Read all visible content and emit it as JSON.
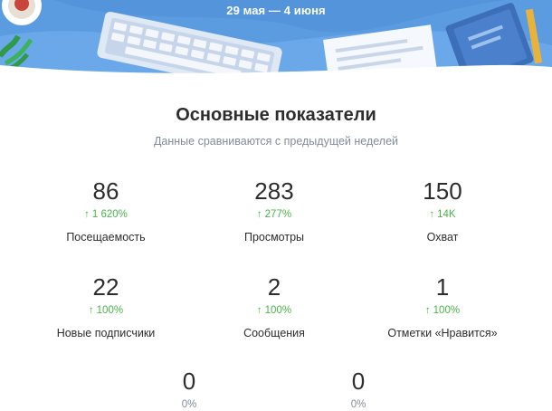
{
  "header": {
    "date_range": "29 мая — 4 июня"
  },
  "section": {
    "title": "Основные показатели",
    "subtitle": "Данные сравниваются с предыдущей неделей"
  },
  "metrics": [
    {
      "value": "86",
      "change": "1 620%",
      "arrow": "↑",
      "label": "Посещаемость"
    },
    {
      "value": "283",
      "change": "277%",
      "arrow": "↑",
      "label": "Просмотры"
    },
    {
      "value": "150",
      "change": "14K",
      "arrow": "↑",
      "label": "Охват"
    },
    {
      "value": "22",
      "change": "100%",
      "arrow": "↑",
      "label": "Новые подписчики"
    },
    {
      "value": "2",
      "change": "100%",
      "arrow": "↑",
      "label": "Сообщения"
    },
    {
      "value": "1",
      "change": "100%",
      "arrow": "↑",
      "label": "Отметки «Нравится»"
    },
    {
      "value": "0",
      "change": "0%"
    },
    {
      "value": "0",
      "change": "0%"
    }
  ],
  "colors": {
    "banner_blue": "#5b9be0",
    "positive_green": "#4bb34b",
    "muted_gray": "#818c99",
    "text_dark": "#2c2d2e"
  },
  "icons": [
    "arrow-up-icon"
  ]
}
